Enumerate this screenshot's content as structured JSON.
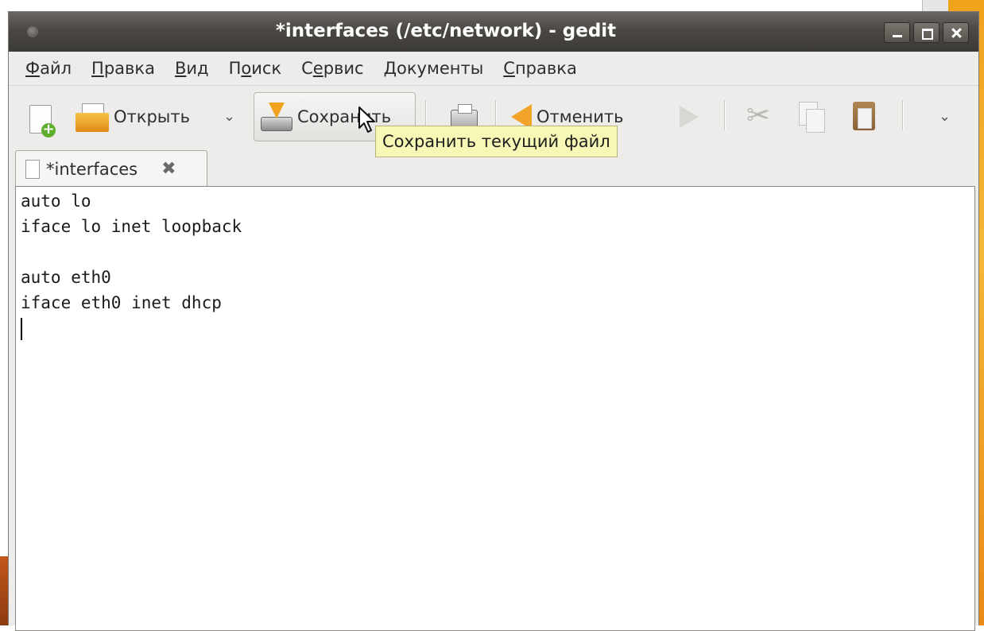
{
  "window": {
    "title": "*interfaces (/etc/network) - gedit"
  },
  "menubar": [
    {
      "accel": "Ф",
      "rest": "айл"
    },
    {
      "accel": "П",
      "rest": "равка"
    },
    {
      "accel": "В",
      "rest": "ид"
    },
    {
      "pre": "П",
      "accel": "о",
      "rest": "иск"
    },
    {
      "pre": "С",
      "accel": "е",
      "rest": "рвис"
    },
    {
      "accel": "Д",
      "rest": "окументы"
    },
    {
      "accel": "С",
      "rest": "правка"
    }
  ],
  "toolbar": {
    "open_label": "Открыть",
    "save_label": "Сохранить",
    "undo_label": "Отменить"
  },
  "tooltip": {
    "text": "Сохранить текущий файл"
  },
  "tab": {
    "label": "*interfaces"
  },
  "editor": {
    "lines": [
      "auto lo",
      "iface lo inet loopback",
      "",
      "auto eth0",
      "iface eth0 inet dhcp",
      ""
    ]
  },
  "colors": {
    "accent": "#f3a21d",
    "tooltip_bg": "#f7f7b6"
  }
}
